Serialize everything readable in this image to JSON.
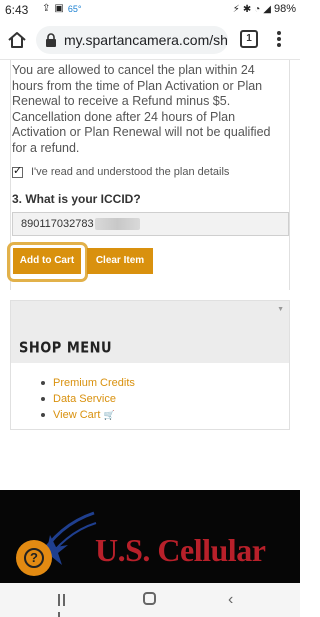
{
  "status_bar": {
    "time": "6:43",
    "temperature": "65°",
    "battery": "98%"
  },
  "browser": {
    "url": "my.spartancamera.com/sho",
    "tab_count": "1"
  },
  "plan": {
    "refund_text": "You are allowed to cancel the plan within 24 hours from the time of Plan Activation or Plan Renewal to receive a Refund minus $5. Cancellation done after 24 hours of Plan Activation or Plan Renewal will not be qualified for a refund.",
    "agree_label": "I've read and understood the plan details",
    "agree_checked": true
  },
  "iccid": {
    "label": "3. What is your ICCID?",
    "value": "890117032783"
  },
  "buttons": {
    "add_to_cart": "Add to Cart",
    "clear_item": "Clear Item"
  },
  "shop_menu": {
    "title": "SHOP MENU",
    "items": [
      {
        "label": "Premium Credits"
      },
      {
        "label": "Data Service"
      },
      {
        "label": "View Cart"
      }
    ]
  },
  "banner": {
    "brand": "U.S. Cellular"
  },
  "help": {
    "symbol": "?"
  },
  "colors": {
    "accent": "#d9910e",
    "highlight_ring": "#e2b14a",
    "brand_red": "#b8202a"
  }
}
